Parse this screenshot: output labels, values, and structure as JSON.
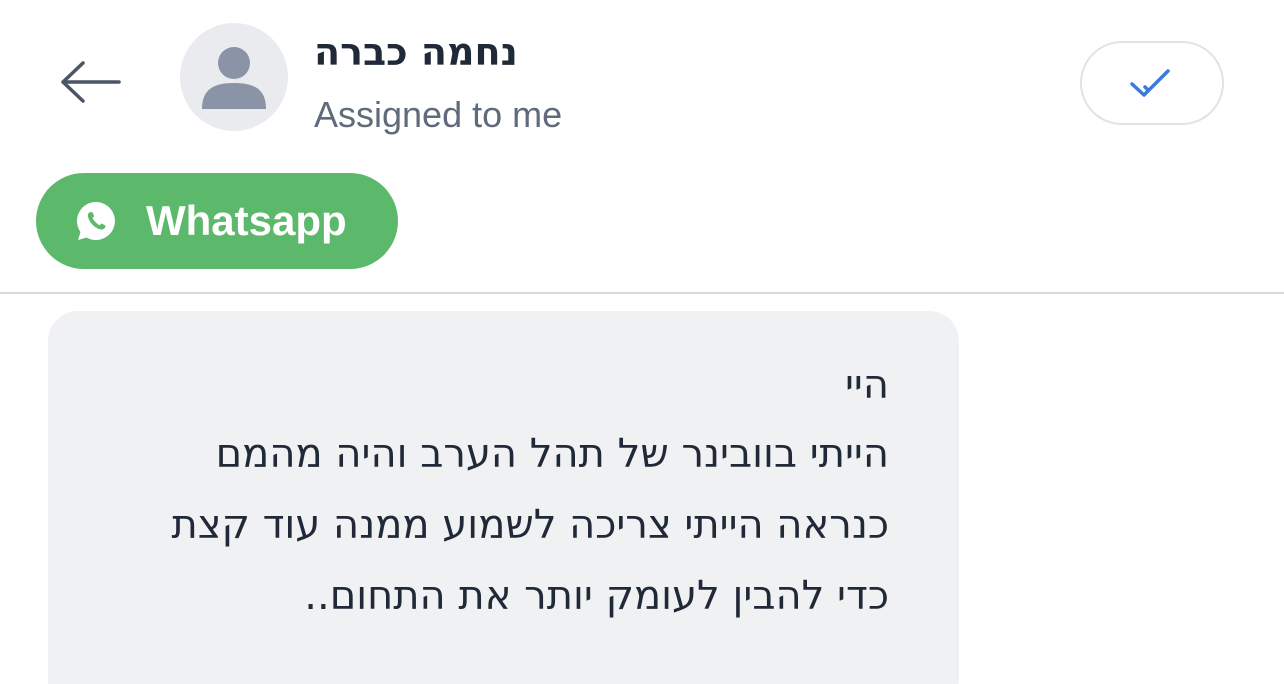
{
  "header": {
    "back_icon": "arrow-left-icon",
    "avatar_icon": "person-icon",
    "contact_name": "נחמה כברה",
    "status": "Assigned to me",
    "resolve_icon": "check-icon",
    "accent_color": "#3b7ad9"
  },
  "channel": {
    "label": "Whatsapp",
    "icon": "whatsapp-icon",
    "color": "#5cb96c"
  },
  "message": {
    "lines": [
      "היי",
      "הייתי בוובינר של תהל הערב והיה מהמם",
      "כנראה הייתי צריכה לשמוע ממנה עוד קצת",
      "כדי להבין לעומק יותר את התחום.."
    ]
  }
}
